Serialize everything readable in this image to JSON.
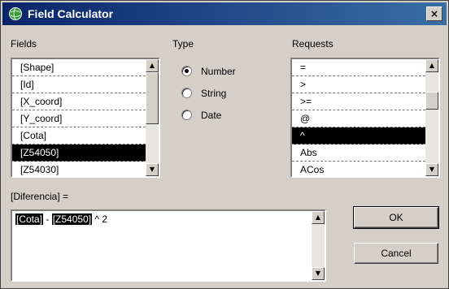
{
  "window": {
    "title": "Field Calculator",
    "close_label": "×"
  },
  "fields": {
    "label": "Fields",
    "items": [
      "[Shape]",
      "[Id]",
      "[X_coord]",
      "[Y_coord]",
      "[Cota]",
      "[Z54050]",
      "[Z54030]"
    ],
    "selected_index": 5
  },
  "type": {
    "label": "Type",
    "options": [
      "Number",
      "String",
      "Date"
    ],
    "selected": "Number"
  },
  "requests": {
    "label": "Requests",
    "items": [
      "=",
      ">",
      ">=",
      "@",
      "^",
      "Abs",
      "ACos"
    ],
    "selected_index": 4
  },
  "expression": {
    "label": "[Diferencia] =",
    "tokens": [
      "[Cota]",
      " - ",
      "[Z54050]",
      " ^ 2"
    ]
  },
  "buttons": {
    "ok": "OK",
    "cancel": "Cancel"
  }
}
